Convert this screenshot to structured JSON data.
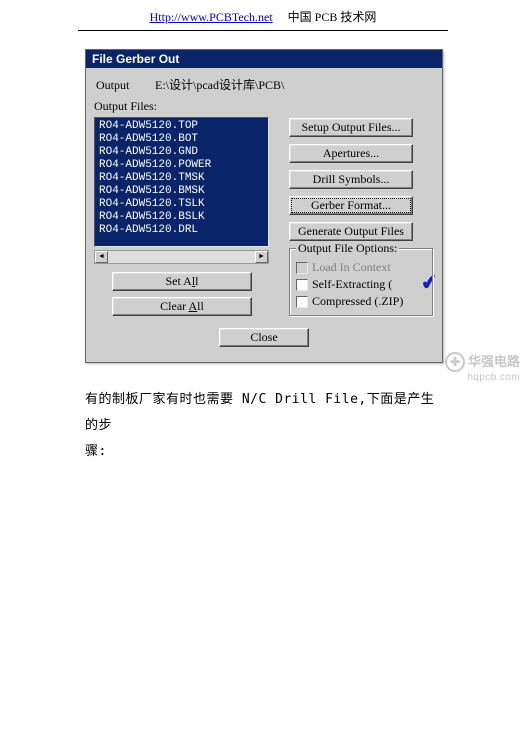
{
  "header": {
    "link": "Http://www.PCBTech.net",
    "text": "中国 PCB 技术网"
  },
  "dialog": {
    "title": "File Gerber Out",
    "output_label": "Output",
    "output_path": "E:\\设计\\pcad设计库\\PCB\\",
    "files_label": "Output Files:",
    "files": [
      "RO4-ADW5120.TOP",
      "RO4-ADW5120.BOT",
      "RO4-ADW5120.GND",
      "RO4-ADW5120.POWER",
      "RO4-ADW5120.TMSK",
      "RO4-ADW5120.BMSK",
      "RO4-ADW5120.TSLK",
      "RO4-ADW5120.BSLK",
      "RO4-ADW5120.DRL"
    ],
    "buttons": {
      "setup": "Setup Output Files...",
      "apertures": "Apertures...",
      "drill": "Drill Symbols...",
      "gerber": "Gerber Format...",
      "generate": "Generate Output Files",
      "set_all_pre": "Set A",
      "set_all_u": "l",
      "set_all_post": "l",
      "clear_all_pre": "Clear ",
      "clear_all_u": "A",
      "clear_all_post": "ll",
      "close": "Close"
    },
    "group": {
      "title": "Output File Options:",
      "opt_load": "Load In Context",
      "opt_self": "Self-Extracting (",
      "opt_zip": "Compressed (.ZIP)"
    },
    "scroll": {
      "left": "◄",
      "right": "►"
    }
  },
  "body_text_line1": "有的制板厂家有时也需要 N/C Drill File,下面是产生的步",
  "body_text_line2": "骤:",
  "watermark": {
    "brand": "华强电路",
    "sub": "hqpcb.com",
    "icon": "✚"
  }
}
